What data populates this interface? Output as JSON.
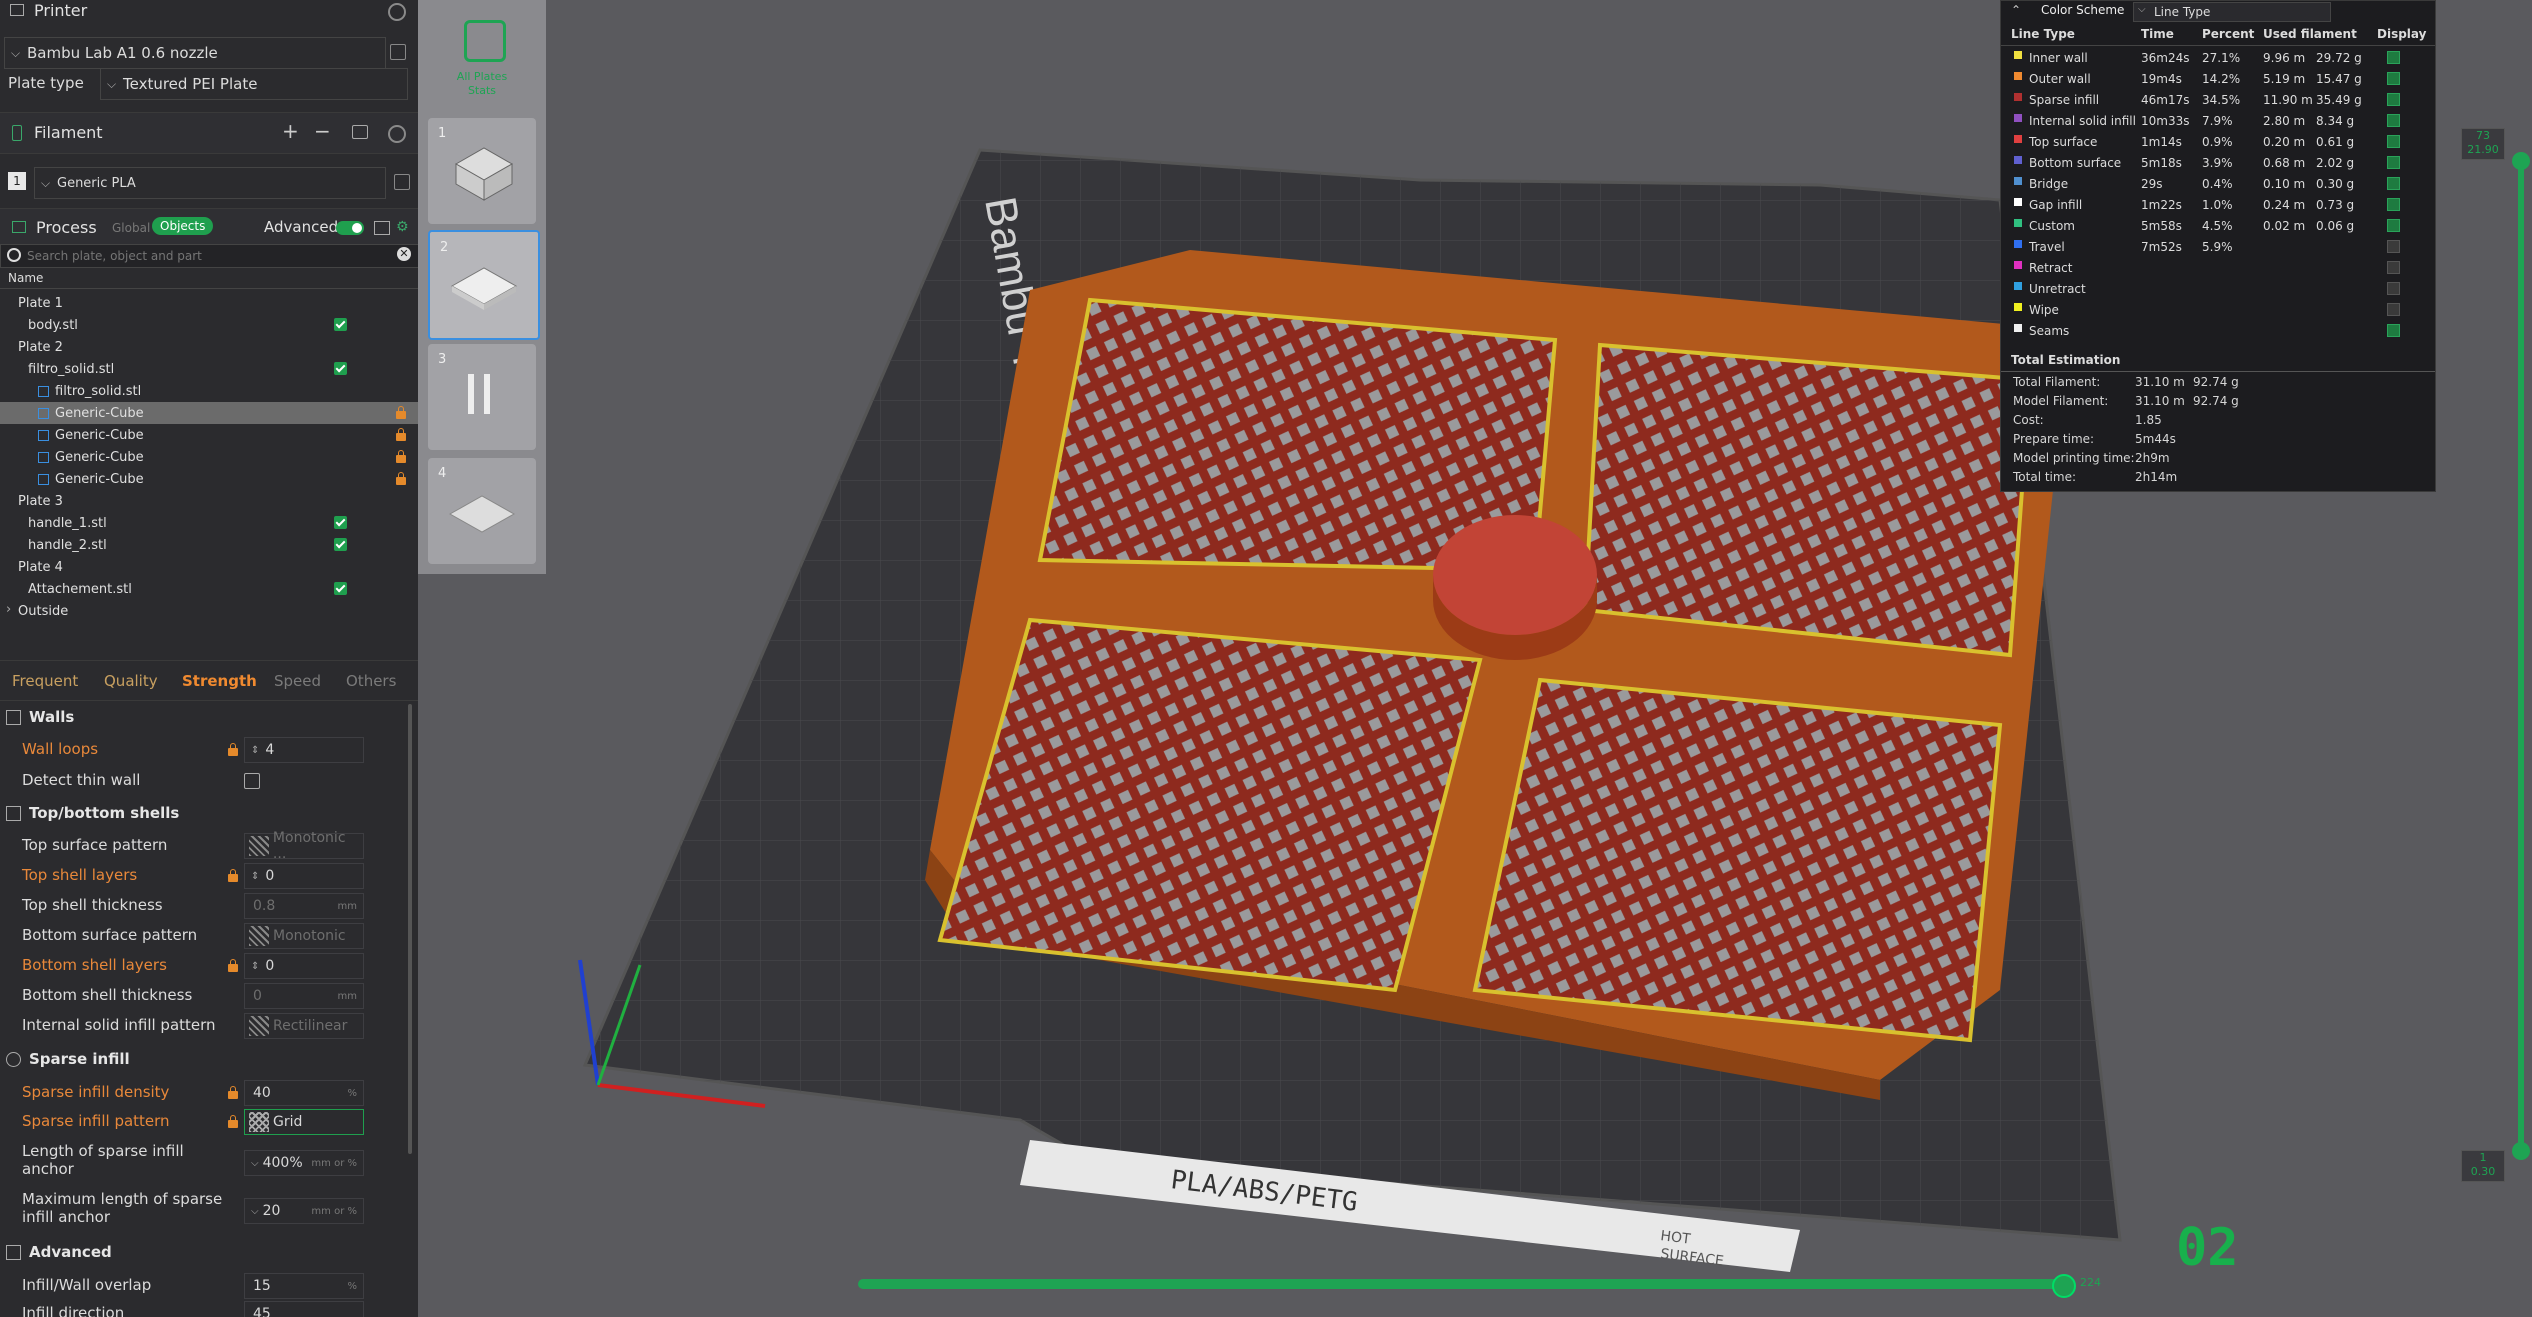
{
  "printer": {
    "title": "Printer",
    "model": "Bambu Lab A1 0.6 nozzle",
    "plate_type_label": "Plate type",
    "plate_type_value": "Textured PEI Plate"
  },
  "filament": {
    "title": "Filament",
    "slot": "1",
    "name": "Generic PLA"
  },
  "process": {
    "title": "Process",
    "global_label": "Global",
    "objects_label": "Objects",
    "advanced_label": "Advanced",
    "search_placeholder": "Search plate, object and part",
    "name_header": "Name"
  },
  "tree": [
    {
      "label": "Plate 1",
      "indent": 0
    },
    {
      "label": "body.stl",
      "indent": 1
    },
    {
      "label": "Plate 2",
      "indent": 0
    },
    {
      "label": "filtro_solid.stl",
      "indent": 1
    },
    {
      "label": "filtro_solid.stl",
      "indent": 2
    },
    {
      "label": "Generic-Cube",
      "indent": 2
    },
    {
      "label": "Generic-Cube",
      "indent": 2
    },
    {
      "label": "Generic-Cube",
      "indent": 2
    },
    {
      "label": "Generic-Cube",
      "indent": 2
    },
    {
      "label": "Plate 3",
      "indent": 0
    },
    {
      "label": "handle_1.stl",
      "indent": 1
    },
    {
      "label": "handle_2.stl",
      "indent": 1
    },
    {
      "label": "Plate 4",
      "indent": 0
    },
    {
      "label": "Attachement.stl",
      "indent": 1
    },
    {
      "label": "Outside",
      "indent": 0
    }
  ],
  "tabs": [
    "Frequent",
    "Quality",
    "Strength",
    "Speed",
    "Others"
  ],
  "walls": {
    "group": "Walls",
    "wall_loops_label": "Wall loops",
    "wall_loops_value": "4",
    "detect_thin_wall_label": "Detect thin wall"
  },
  "topbottom": {
    "group": "Top/bottom shells",
    "top_surface_pattern_label": "Top surface pattern",
    "top_surface_pattern_value": "Monotonic ...",
    "top_shell_layers_label": "Top shell layers",
    "top_shell_layers_value": "0",
    "top_shell_thickness_label": "Top shell thickness",
    "top_shell_thickness_value": "0.8",
    "bottom_surface_pattern_label": "Bottom surface pattern",
    "bottom_surface_pattern_value": "Monotonic",
    "bottom_shell_layers_label": "Bottom shell layers",
    "bottom_shell_layers_value": "0",
    "bottom_shell_thickness_label": "Bottom shell thickness",
    "bottom_shell_thickness_value": "0",
    "internal_solid_label": "Internal solid infill pattern",
    "internal_solid_value": "Rectilinear",
    "unit_mm": "mm"
  },
  "sparse": {
    "group": "Sparse infill",
    "density_label": "Sparse infill density",
    "density_value": "40",
    "pattern_label": "Sparse infill pattern",
    "pattern_value": "Grid",
    "anchor_label_1": "Length of sparse infill",
    "anchor_label_2": "anchor",
    "anchor_value": "400%",
    "max_anchor_label_1": "Maximum length of sparse",
    "max_anchor_label_2": "infill anchor",
    "max_anchor_value": "20",
    "unit_mm_or_pct": "mm or %",
    "unit_pct": "%"
  },
  "advanced": {
    "group": "Advanced",
    "overlap_label": "Infill/Wall overlap",
    "overlap_value": "15",
    "direction_label": "Infill direction",
    "direction_value": "45"
  },
  "plates_strip": {
    "stats_label_1": "All Plates",
    "stats_label_2": "Stats",
    "numbers": [
      "1",
      "2",
      "3",
      "4"
    ]
  },
  "bed": {
    "label": "Bambu Textured PEI Plate",
    "sticker": "PLA/ABS/PETG",
    "hot_1": "HOT",
    "hot_2": "SURFACE"
  },
  "color_scheme": {
    "title": "Color Scheme",
    "value": "Line Type",
    "headers": [
      "Line Type",
      "Time",
      "Percent",
      "Used filament",
      "Display"
    ],
    "rows": [
      {
        "name": "Inner wall",
        "color": "#f0e040",
        "time": "36m24s",
        "pct": "27.1%",
        "len": "9.96 m",
        "g": "29.72 g",
        "on": true
      },
      {
        "name": "Outer wall",
        "color": "#f08a30",
        "time": "19m4s",
        "pct": "14.2%",
        "len": "5.19 m",
        "g": "15.47 g",
        "on": true
      },
      {
        "name": "Sparse infill",
        "color": "#b03030",
        "time": "46m17s",
        "pct": "34.5%",
        "len": "11.90 m",
        "g": "35.49 g",
        "on": true
      },
      {
        "name": "Internal solid infill",
        "color": "#9050c0",
        "time": "10m33s",
        "pct": "7.9%",
        "len": "2.80 m",
        "g": "8.34 g",
        "on": true
      },
      {
        "name": "Top surface",
        "color": "#e04040",
        "time": "1m14s",
        "pct": "0.9%",
        "len": "0.20 m",
        "g": "0.61 g",
        "on": true
      },
      {
        "name": "Bottom surface",
        "color": "#6060d0",
        "time": "5m18s",
        "pct": "3.9%",
        "len": "0.68 m",
        "g": "2.02 g",
        "on": true
      },
      {
        "name": "Bridge",
        "color": "#5090d0",
        "time": "29s",
        "pct": "0.4%",
        "len": "0.10 m",
        "g": "0.30 g",
        "on": true
      },
      {
        "name": "Gap infill",
        "color": "#ffffff",
        "time": "1m22s",
        "pct": "1.0%",
        "len": "0.24 m",
        "g": "0.73 g",
        "on": true
      },
      {
        "name": "Custom",
        "color": "#30c080",
        "time": "5m58s",
        "pct": "4.5%",
        "len": "0.02 m",
        "g": "0.06 g",
        "on": true
      },
      {
        "name": "Travel",
        "color": "#3070f0",
        "time": "7m52s",
        "pct": "5.9%",
        "len": "",
        "g": "",
        "on": false
      },
      {
        "name": "Retract",
        "color": "#e030c0",
        "time": "",
        "pct": "",
        "len": "",
        "g": "",
        "on": false
      },
      {
        "name": "Unretract",
        "color": "#30a0e0",
        "time": "",
        "pct": "",
        "len": "",
        "g": "",
        "on": false
      },
      {
        "name": "Wipe",
        "color": "#f0f020",
        "time": "",
        "pct": "",
        "len": "",
        "g": "",
        "on": false
      },
      {
        "name": "Seams",
        "color": "#f0f0f0",
        "time": "",
        "pct": "",
        "len": "",
        "g": "",
        "on": true
      }
    ],
    "estimation_title": "Total Estimation",
    "estimation": [
      {
        "label": "Total Filament:",
        "v1": "31.10 m",
        "v2": "92.74 g"
      },
      {
        "label": "Model Filament:",
        "v1": "31.10 m",
        "v2": "92.74 g"
      },
      {
        "label": "Cost:",
        "v1": "1.85",
        "v2": ""
      },
      {
        "label": "Prepare time:",
        "v1": "5m44s",
        "v2": ""
      },
      {
        "label": "Model printing time:",
        "v1": "2h9m",
        "v2": ""
      },
      {
        "label": "Total time:",
        "v1": "2h14m",
        "v2": ""
      }
    ]
  },
  "layer_slider": {
    "top_1": "73",
    "top_2": "21.90",
    "bottom_1": "1",
    "bottom_2": "0.30",
    "move_value": "224",
    "badge": "02"
  }
}
